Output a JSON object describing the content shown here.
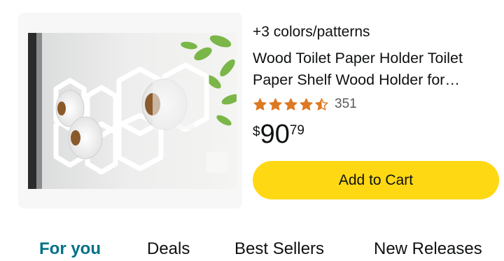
{
  "product": {
    "variants_text": "+3 colors/patterns",
    "title": "Wood Toilet Paper Holder Toilet Paper Shelf Wood Holder for…",
    "rating": {
      "stars": 4.5,
      "max_stars": 5,
      "review_count": "351"
    },
    "price": {
      "symbol": "$",
      "whole": "90",
      "fraction": "79"
    },
    "image_icon": "product-photo"
  },
  "actions": {
    "add_to_cart": "Add to Cart"
  },
  "tabs": [
    {
      "label": "For you",
      "active": true
    },
    {
      "label": "Deals",
      "active": false
    },
    {
      "label": "Best Sellers",
      "active": false
    },
    {
      "label": "New Releases",
      "active": false
    }
  ],
  "colors": {
    "star": "#de7921",
    "button": "#ffd814",
    "active_tab": "#007185",
    "card_bg": "#f7f7f7"
  }
}
